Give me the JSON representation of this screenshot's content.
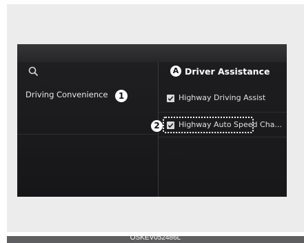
{
  "left_panel": {
    "menu_items": [
      "Driving Convenience"
    ]
  },
  "right_panel": {
    "title": "Driver Assistance",
    "options": [
      {
        "label": "Highway Driving Assist",
        "checked": true
      },
      {
        "label": "Highway Auto Speed Cha...",
        "checked": true
      }
    ]
  },
  "callouts": {
    "one": "1",
    "two": "2",
    "a": "A"
  },
  "caption": "OSKEV052486L",
  "icons": {
    "search": "search-icon",
    "checkbox": "check-icon"
  },
  "colors": {
    "screen_bg": "#1a1a1c",
    "text": "#e8e8e8",
    "callout_bg": "#ffffff",
    "caption_bar": "#5f5f61"
  }
}
